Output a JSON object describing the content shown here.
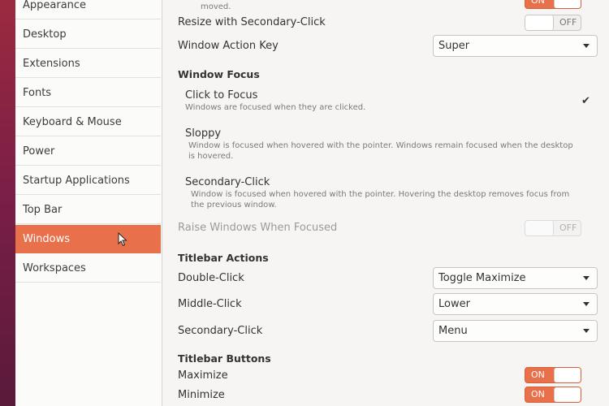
{
  "sidebar": {
    "items": [
      {
        "label": "Appearance",
        "active": false
      },
      {
        "label": "Desktop",
        "active": false
      },
      {
        "label": "Extensions",
        "active": false
      },
      {
        "label": "Fonts",
        "active": false
      },
      {
        "label": "Keyboard & Mouse",
        "active": false
      },
      {
        "label": "Power",
        "active": false
      },
      {
        "label": "Startup Applications",
        "active": false
      },
      {
        "label": "Top Bar",
        "active": false
      },
      {
        "label": "Windows",
        "active": true
      },
      {
        "label": "Workspaces",
        "active": false
      }
    ]
  },
  "windows": {
    "top_partial_text": "moved.",
    "top_toggle_state": "ON",
    "resize_label": "Resize with Secondary-Click",
    "resize_toggle": "OFF",
    "action_key_label": "Window Action Key",
    "action_key_value": "Super",
    "focus_heading": "Window Focus",
    "focus_options": [
      {
        "title": "Click to Focus",
        "desc": "Windows are focused when they are clicked.",
        "selected": true
      },
      {
        "title": "Sloppy",
        "desc1": "Window is focused when hovered with the pointer. Windows remain focused when the desktop",
        "desc2": "is hovered."
      },
      {
        "title": "Secondary-Click",
        "desc1": "Window is focused when hovered with the pointer. Hovering the desktop removes focus from",
        "desc2": "the previous window."
      }
    ],
    "raise_label": "Raise Windows When Focused",
    "raise_toggle": "OFF",
    "titlebar_actions_heading": "Titlebar Actions",
    "double_click_label": "Double-Click",
    "double_click_value": "Toggle Maximize",
    "middle_click_label": "Middle-Click",
    "middle_click_value": "Lower",
    "secondary_click_label": "Secondary-Click",
    "secondary_click_value": "Menu",
    "titlebar_buttons_heading": "Titlebar Buttons",
    "maximize_label": "Maximize",
    "maximize_toggle": "ON",
    "minimize_label": "Minimize",
    "minimize_toggle": "ON"
  },
  "checkmark": "✔",
  "colors": {
    "accent": "#e8704a",
    "window_bg": "#f6f5f4",
    "desktop": "#8a2443"
  }
}
